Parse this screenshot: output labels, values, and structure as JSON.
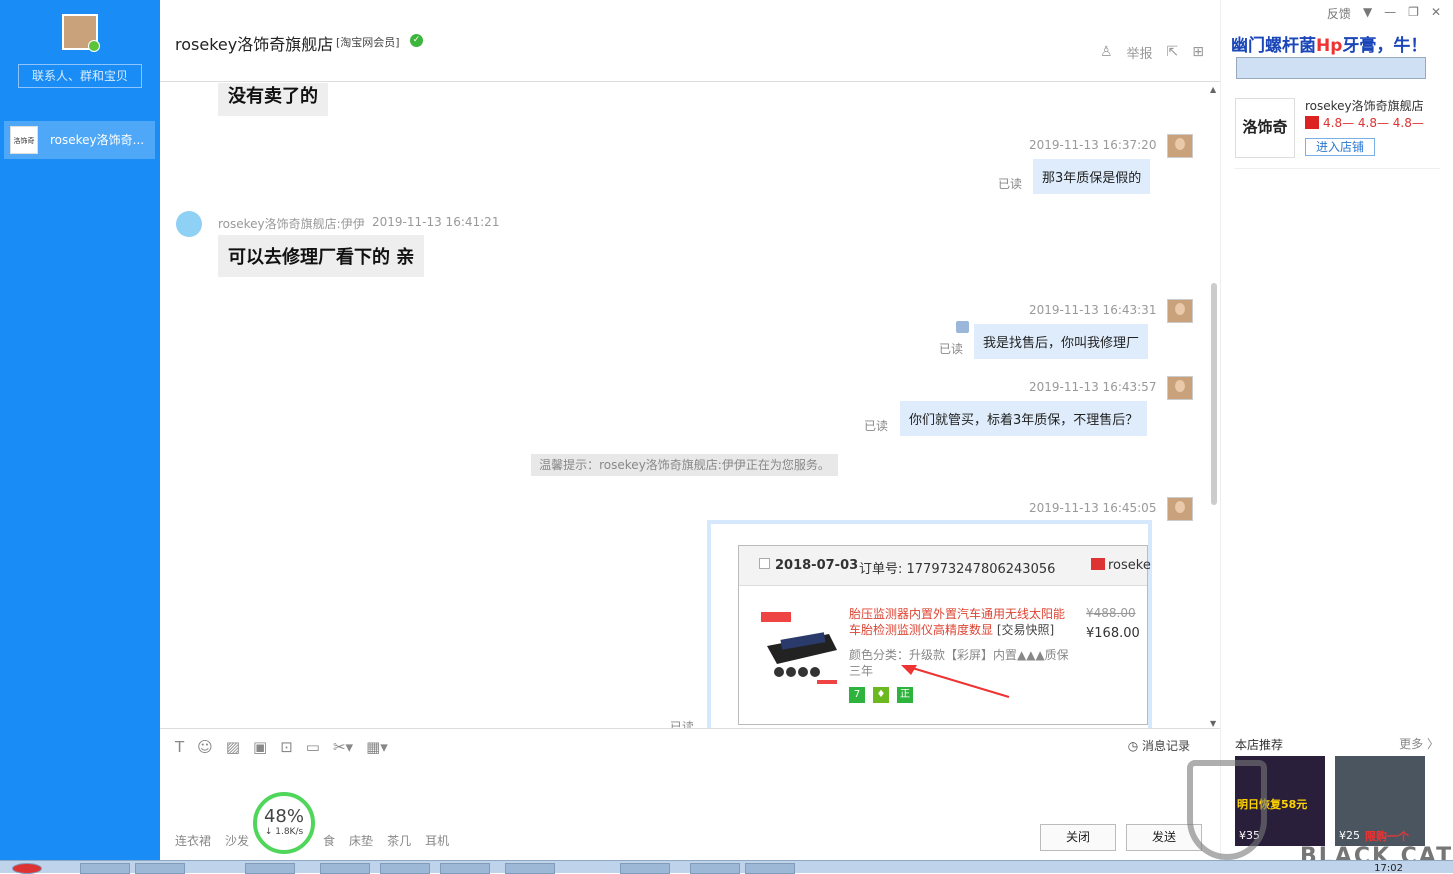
{
  "sidebar": {
    "contacts_button": "联系人、群和宝贝",
    "conversation_label": "rosekey洛饰奇...",
    "conversation_icon_text": "洛饰奇"
  },
  "header": {
    "shop_name": "rosekey洛饰奇旗舰店",
    "member_tag": "[淘宝网会员]",
    "report_label": "举报"
  },
  "messages": {
    "m1_text": "没有卖了的",
    "m2_time": "2019-11-13 16:37:20",
    "m2_text": "那3年质保是假的",
    "m3_sender": "rosekey洛饰奇旗舰店:伊伊",
    "m3_time": "2019-11-13 16:41:21",
    "m3_text": "可以去修理厂看下的 亲",
    "m4_time": "2019-11-13 16:43:31",
    "m4_text": "我是找售后，你叫我修理厂",
    "m5_time": "2019-11-13 16:43:57",
    "m5_text": "你们就管买，标着3年质保，不理售后？",
    "system_tip": "温馨提示：rosekey洛饰奇旗舰店:伊伊正在为您服务。",
    "m6_time": "2019-11-13 16:45:05",
    "read_label": "已读"
  },
  "order_card": {
    "date": "2018-07-03",
    "order_label": "订单号: 177973247806243056",
    "shop": "roseke",
    "product_name": "胎压监测器内置外置汽车通用无线太阳能车胎检测监测仪高精度数显",
    "snapshot": "[交易快照]",
    "original_price": "¥488.00",
    "price": "¥168.00",
    "attributes": "颜色分类：升级款【彩屏】内置▲▲▲质保三年",
    "badges": [
      "7",
      "",
      "正"
    ]
  },
  "toolbar": {
    "history_label": "消息记录"
  },
  "input": {
    "tags": [
      "连衣裙",
      "沙发",
      "食",
      "床垫",
      "茶几",
      "耳机"
    ],
    "close_button": "关闭",
    "send_button": "发送"
  },
  "speed_widget": {
    "percent": "48%",
    "rate": "↓ 1.8K/s"
  },
  "right_panel": {
    "window_controls": [
      "反馈",
      "▼",
      "—",
      "❐",
      "✕"
    ],
    "ad_text_a": "幽门螺杆菌",
    "ad_text_b": "Hp",
    "ad_text_c": "牙膏，牛！",
    "shop_name": "rosekey洛饰奇旗舰店",
    "scores": "4.8— 4.8— 4.8—",
    "enter_shop": "进入店铺",
    "logo_text": "洛饰奇",
    "recommend_title": "本店推荐",
    "more_label": "更多 〉",
    "products": [
      {
        "promo": "明日恢复58元",
        "price": "¥35"
      },
      {
        "promo": "限购一个",
        "price": "¥25"
      }
    ]
  },
  "taskbar": {
    "clock": "17:02"
  },
  "watermark": "BLACK CAT"
}
